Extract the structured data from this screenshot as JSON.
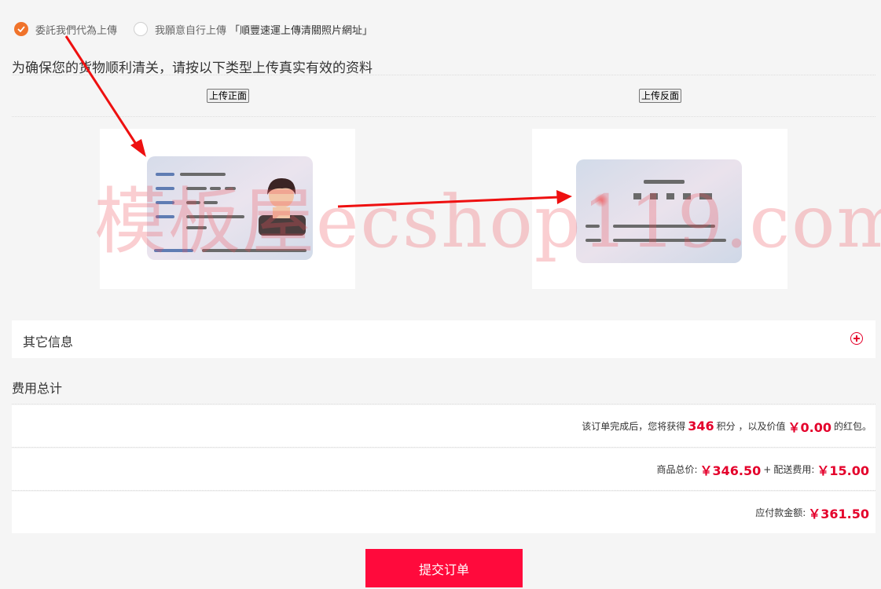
{
  "upload_options": {
    "option1": "委託我們代為上傳",
    "option2": "我願意自行上傳",
    "option2_link": "「順豐速運上傳清關照片網址」",
    "selected": "option1"
  },
  "id_section": {
    "title": "为确保您的货物顺利清关，请按以下类型上传真实有效的资料",
    "front_button": "上传正面",
    "back_button": "上传反面"
  },
  "watermark": "模板屋ecshop119.com",
  "other_info": {
    "label": "其它信息"
  },
  "fees": {
    "title": "费用总计",
    "points_prefix": "该订单完成后，您将获得",
    "points": "346",
    "points_suffix": "积分 ，以及价值",
    "bonus": "￥0.00",
    "bonus_suffix": "的红包。",
    "goods_label": "商品总价:",
    "goods_total": "￥346.50",
    "plus": "+",
    "shipping_label": "配送费用:",
    "shipping": "￥15.00",
    "payable_label": "应付款金额:",
    "payable": "￥361.50"
  },
  "submit_button": "提交订单",
  "colors": {
    "accent_red": "#e4002b",
    "submit_bg": "#ff0a3c",
    "radio_orange": "#f0732b"
  },
  "icons": {
    "checked": "radio-checked-icon",
    "plus": "plus-circle-icon",
    "id_front": "id-card-front-icon",
    "id_back": "id-card-back-icon"
  }
}
